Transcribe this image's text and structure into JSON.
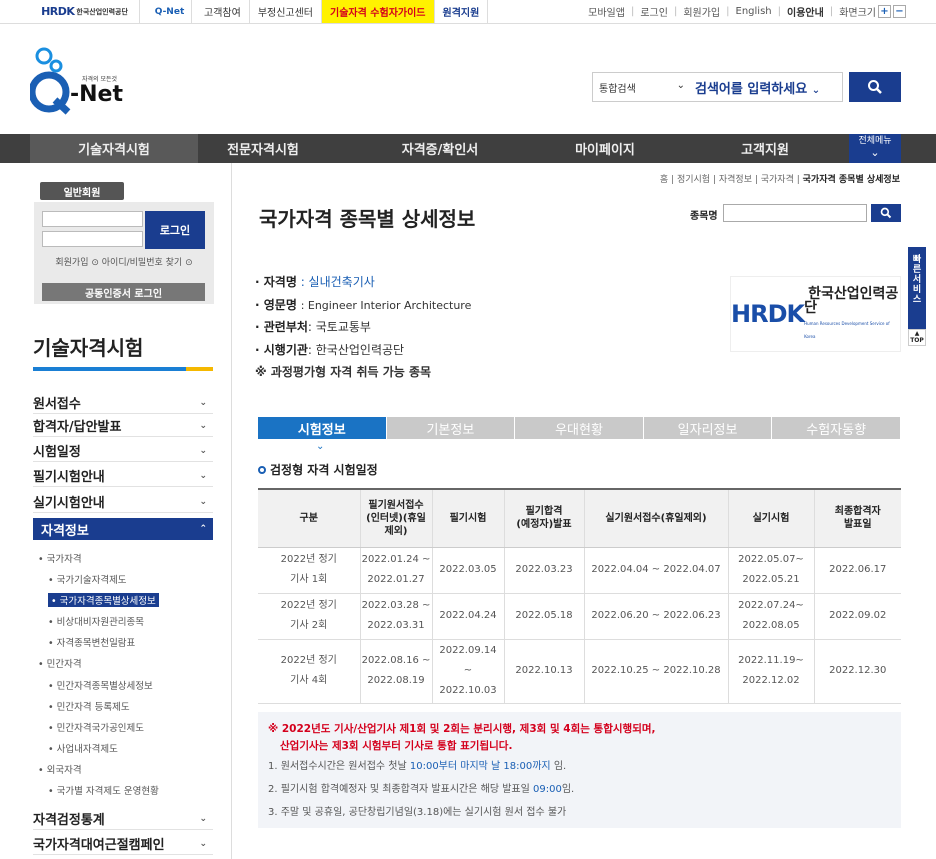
{
  "topbar": {
    "hrdk_logo": "HRDK",
    "hrdk_name": "한국산업인력공단",
    "qnet_logo": "Q-Net",
    "links": [
      "고객참여",
      "부정신고센터",
      "기술자격 수험자가이드",
      "원격지원"
    ],
    "right_links": [
      "모바일앱",
      "로그인",
      "회원가입",
      "English",
      "이용안내",
      "화면크기"
    ],
    "zoom_in": "+",
    "zoom_out": "−"
  },
  "header": {
    "logo_sub": "자격의 모든것",
    "logo_text": "Q-Net",
    "search_category": "통합검색",
    "search_placeholder": "검색어를 입력하세요"
  },
  "gnb": [
    "기술자격시험",
    "전문자격시험",
    "자격증/확인서",
    "마이페이지",
    "고객지원"
  ],
  "all_menu": "전체메뉴",
  "sidebar": {
    "member_tag": "일반회원",
    "login_label": "로그인",
    "join_label": "회원가입",
    "find_label": "아이디/비밀번호 찾기",
    "cert_login": "공동인증서 로그인",
    "title": "기술자격시험",
    "menus": [
      "원서접수",
      "합격자/답안발표",
      "시험일정",
      "필기시험안내",
      "실기시험안내",
      "자격정보"
    ],
    "sub_national": "국가자격",
    "sub_national_items": [
      "국가기술자격제도",
      "국가자격종목별상세정보",
      "비상대비자원관리종목",
      "자격종목변천일람표"
    ],
    "sub_private": "민간자격",
    "sub_private_items": [
      "민간자격종목별상세정보",
      "민간자격 등록제도",
      "민간자격국가공인제도",
      "사업내자격제도"
    ],
    "sub_foreign": "외국자격",
    "sub_foreign_items": [
      "국가별 자격제도 운영현황"
    ],
    "bottom_menus": [
      "자격검정통계",
      "국가자격대여근절캠페인"
    ]
  },
  "breadcrumb": [
    "홈",
    "정기시험",
    "자격정보",
    "국가자격",
    "국가자격 종목별 상세정보"
  ],
  "page": {
    "title": "국가자격 종목별 상세정보",
    "search_label": "종목명"
  },
  "info": {
    "name_key": "· 자격명",
    "name_val": ": 실내건축기사",
    "en_key": "· 영문명",
    "en_val": ": Engineer Interior Architecture",
    "dept_key": "· 관련부처",
    "dept_val": ": 국토교통부",
    "org_key": "· 시행기관",
    "org_val": ": 한국산업인력공단",
    "note": "※ 과정평가형 자격 취득 가능 종목"
  },
  "org_logo": {
    "big": "HRDK",
    "kr": "한국산업인력공단",
    "en": "Human Resources Development Service of Korea"
  },
  "tabs": [
    "시험정보",
    "기본정보",
    "우대현황",
    "일자리정보",
    "수험자동향"
  ],
  "section_title": "검정형 자격 시험일정",
  "schedule": {
    "headers": [
      "구분",
      "필기원서접수\n(인터넷)(휴일\n제외)",
      "필기시험",
      "필기합격\n(예정자)발표",
      "실기원서접수(휴일제외)",
      "실기시험",
      "최종합격자\n발표일"
    ],
    "rows": [
      [
        "2022년 정기\n기사 1회",
        "2022.01.24 ~\n2022.01.27",
        "2022.03.05",
        "2022.03.23",
        "2022.04.04 ~ 2022.04.07",
        "2022.05.07~\n2022.05.21",
        "2022.06.17"
      ],
      [
        "2022년 정기\n기사 2회",
        "2022.03.28 ~\n2022.03.31",
        "2022.04.24",
        "2022.05.18",
        "2022.06.20 ~ 2022.06.23",
        "2022.07.24~\n2022.08.05",
        "2022.09.02"
      ],
      [
        "2022년 정기\n기사 4회",
        "2022.08.16 ~\n2022.08.19",
        "2022.09.14\n~\n2022.10.03",
        "2022.10.13",
        "2022.10.25 ~ 2022.10.28",
        "2022.11.19~\n2022.12.02",
        "2022.12.30"
      ]
    ]
  },
  "notice": {
    "red1": "※ 2022년도 기사/산업기사 제1회 및 2회는 분리시행, 제3회 및 4회는 통합시행되며,",
    "red2": "산업기사는 제3회 시험부터 기사로 통합 표기됩니다.",
    "n1a": "1. 원서접수시간은 원서접수 첫날 ",
    "n1b": "10:00부터 마지막 날 18:00까지",
    "n1c": " 임.",
    "n2a": "2. 필기시험 합격예정자 및 최종합격자 발표시간은 해당 발표일 ",
    "n2b": "09:00",
    "n2c": "임.",
    "n3": "3. 주말 및 공휴일, 공단창립기념일(3.18)에는 실기시험 원서 접수 불가"
  },
  "quick": "빠른서비스",
  "top_label": "TOP"
}
